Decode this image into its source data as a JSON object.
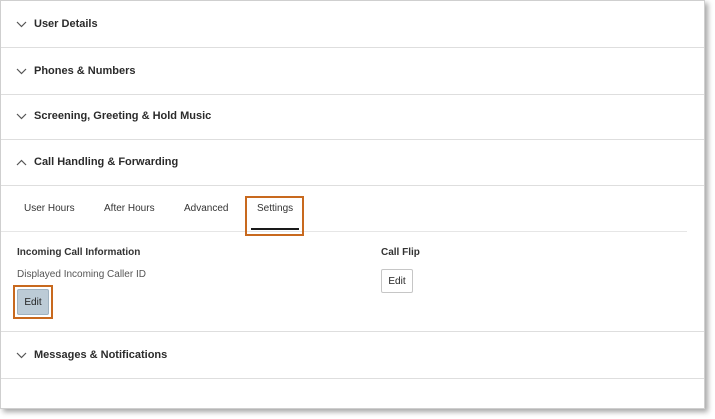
{
  "sections": [
    {
      "title": "User Details",
      "expanded": false
    },
    {
      "title": "Phones & Numbers",
      "expanded": false
    },
    {
      "title": "Screening, Greeting & Hold Music",
      "expanded": false
    },
    {
      "title": "Call Handling & Forwarding",
      "expanded": true
    },
    {
      "title": "Messages & Notifications",
      "expanded": false
    }
  ],
  "tabs": [
    {
      "label": "User Hours",
      "active": false
    },
    {
      "label": "After Hours",
      "active": false
    },
    {
      "label": "Advanced",
      "active": false
    },
    {
      "label": "Settings",
      "active": true
    }
  ],
  "incoming": {
    "heading": "Incoming Call Information",
    "caller_id_label": "Displayed Incoming Caller ID",
    "edit_label": "Edit"
  },
  "call_flip": {
    "heading": "Call Flip",
    "edit_label": "Edit"
  },
  "colors": {
    "highlight": "#c8691e",
    "active_button_bg": "#bccbd6"
  }
}
